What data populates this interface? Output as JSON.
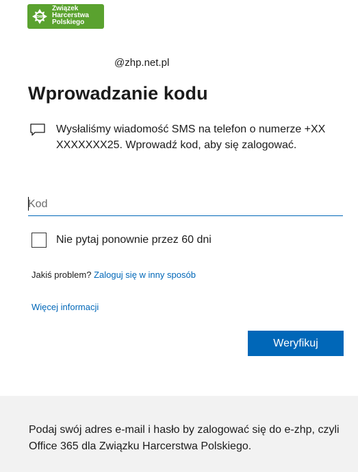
{
  "logo": {
    "line1": "Związek",
    "line2": "Harcerstwa",
    "line3": "Polskiego",
    "emblem": "ZHP"
  },
  "identity": {
    "email_suffix": "@zhp.net.pl"
  },
  "title": "Wprowadzanie kodu",
  "sms_message": "Wysłaliśmy wiadomość SMS na telefon o numerze +XX XXXXXXX25. Wprowadź kod, aby się zalogować.",
  "code_input": {
    "placeholder": "Kod",
    "value": ""
  },
  "kmsi": {
    "label": "Nie pytaj ponownie przez 60 dni",
    "checked": false
  },
  "problem": {
    "prefix": "Jakiś problem?",
    "link": "Zaloguj się w inny sposób"
  },
  "more_info": "Więcej informacji",
  "verify_button": "Weryfikuj",
  "footer": {
    "text": "Podaj swój adres e-mail i hasło by zalogować się do e-zhp, czyli Office 365 dla Związku Harcerstwa Polskiego."
  },
  "colors": {
    "accent": "#0067b8",
    "logo_green": "#5aa22f",
    "footer_bg": "#f2f2f2"
  }
}
